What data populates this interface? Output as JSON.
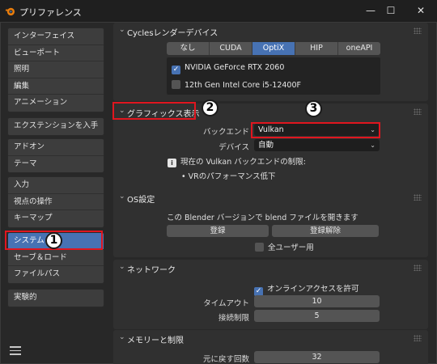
{
  "window": {
    "title": "プリファレンス",
    "minimize": "—",
    "maximize": "☐",
    "close": "✕"
  },
  "sidebar": {
    "groups": [
      [
        "インターフェイス",
        "ビューポート",
        "照明",
        "編集",
        "アニメーション"
      ],
      [
        "エクステンションを入手"
      ],
      [
        "アドオン",
        "テーマ"
      ],
      [
        "入力",
        "視点の操作",
        "キーマップ"
      ],
      [
        "システム",
        "セーブ＆ロード",
        "ファイルパス"
      ],
      [
        "実験的"
      ]
    ],
    "active": "システム"
  },
  "cycles": {
    "title": "Cyclesレンダーデバイス",
    "backends": [
      "なし",
      "CUDA",
      "OptiX",
      "HIP",
      "oneAPI"
    ],
    "selected_backend": "OptiX",
    "devices": [
      {
        "name": "NVIDIA GeForce RTX 2060",
        "checked": true
      },
      {
        "name": "12th Gen Intel Core i5-12400F",
        "checked": false
      }
    ]
  },
  "graphics": {
    "title": "グラフィックス表示",
    "backend_label": "バックエンド",
    "backend_value": "Vulkan",
    "device_label": "デバイス",
    "device_value": "自動",
    "info_title": "現在の Vulkan バックエンドの制限:",
    "info_item": "• VRのパフォーマンス低下"
  },
  "os": {
    "title": "OS設定",
    "text": "この Blender バージョンで blend ファイルを開きます",
    "register": "登録",
    "unregister": "登録解除",
    "all_users": "全ユーザー用"
  },
  "network": {
    "title": "ネットワーク",
    "online_access": "オンラインアクセスを許可",
    "timeout_label": "タイムアウト",
    "timeout_value": "10",
    "conn_label": "接続制限",
    "conn_value": "5"
  },
  "memory": {
    "title": "メモリーと制限",
    "undo_label": "元に戻す回数",
    "undo_value": "32"
  },
  "annotations": {
    "badge1": "1",
    "badge2": "2",
    "badge3": "3"
  },
  "colors": {
    "accent": "#4772b3",
    "highlight_red": "#e0161f"
  }
}
